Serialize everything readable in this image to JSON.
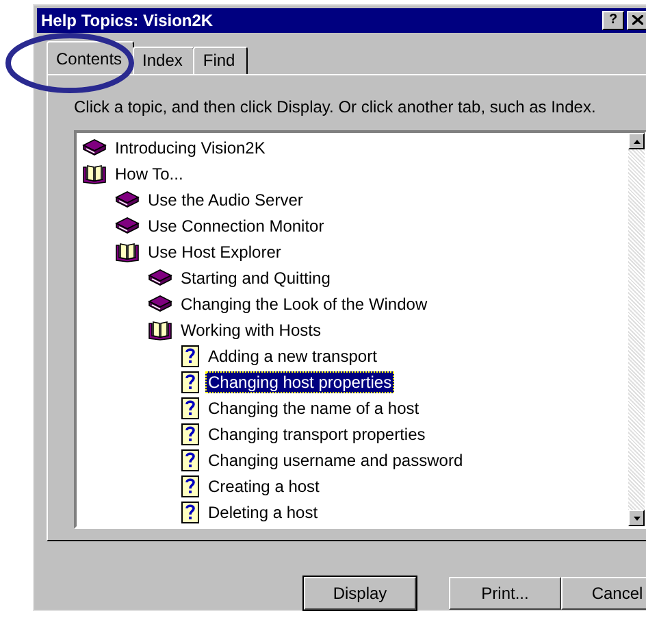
{
  "window": {
    "title": "Help Topics: Vision2K",
    "help_button": "?"
  },
  "tabs": [
    {
      "label": "Contents",
      "selected": true
    },
    {
      "label": "Index",
      "selected": false
    },
    {
      "label": "Find",
      "selected": false
    }
  ],
  "instruction": "Click a topic, and then click Display. Or click another tab, such as Index.",
  "tree": [
    {
      "label": "Introducing Vision2K",
      "kind": "book",
      "expanded": false,
      "selected": false
    },
    {
      "label": "How To...",
      "kind": "book",
      "expanded": true,
      "selected": false,
      "children": [
        {
          "label": "Use the Audio Server",
          "kind": "book",
          "expanded": false,
          "selected": false
        },
        {
          "label": "Use Connection Monitor",
          "kind": "book",
          "expanded": false,
          "selected": false
        },
        {
          "label": "Use Host Explorer",
          "kind": "book",
          "expanded": true,
          "selected": false,
          "children": [
            {
              "label": "Starting and Quitting",
              "kind": "book",
              "expanded": false,
              "selected": false
            },
            {
              "label": "Changing the Look of the Window",
              "kind": "book",
              "expanded": false,
              "selected": false
            },
            {
              "label": "Working with Hosts",
              "kind": "book",
              "expanded": true,
              "selected": false,
              "children": [
                {
                  "label": "Adding a new transport",
                  "kind": "topic",
                  "selected": false
                },
                {
                  "label": "Changing host properties",
                  "kind": "topic",
                  "selected": true
                },
                {
                  "label": "Changing the name of a host",
                  "kind": "topic",
                  "selected": false
                },
                {
                  "label": "Changing transport properties",
                  "kind": "topic",
                  "selected": false
                },
                {
                  "label": "Changing username and password",
                  "kind": "topic",
                  "selected": false
                },
                {
                  "label": "Creating a host",
                  "kind": "topic",
                  "selected": false
                },
                {
                  "label": "Deleting a host",
                  "kind": "topic",
                  "selected": false
                }
              ]
            }
          ]
        }
      ]
    }
  ],
  "buttons": [
    {
      "label": "Display",
      "default": true
    },
    {
      "label": "Print...",
      "default": false
    },
    {
      "label": "Cancel",
      "default": false
    }
  ]
}
